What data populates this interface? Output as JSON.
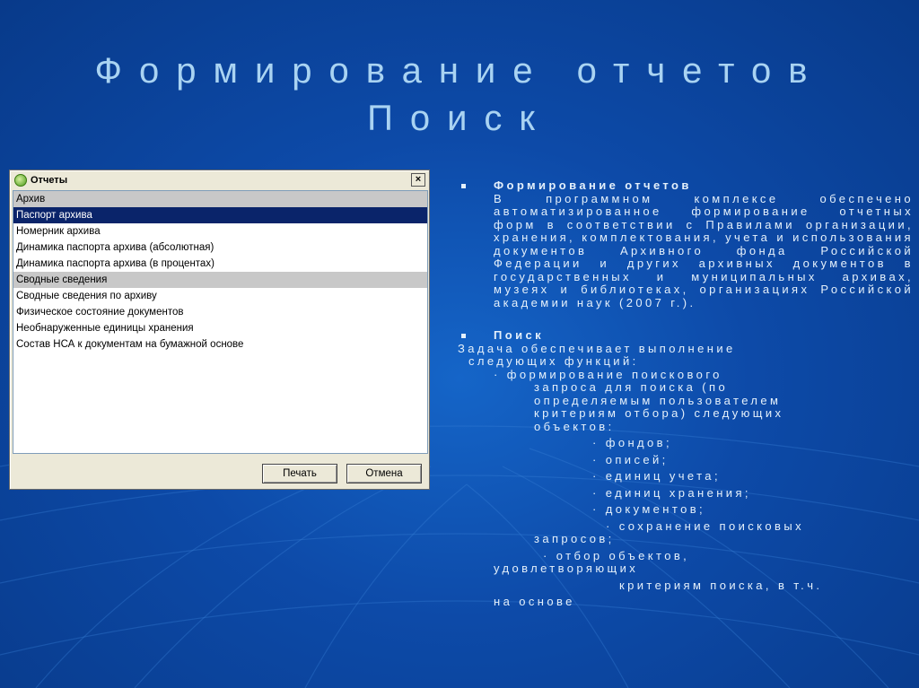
{
  "title": {
    "line1": "Формирование отчетов",
    "line2": "Поиск"
  },
  "dialog": {
    "title": "Отчеты",
    "close": "×",
    "items": [
      {
        "label": "Архив",
        "kind": "group"
      },
      {
        "label": "Паспорт архива",
        "kind": "selected"
      },
      {
        "label": "Номерник архива",
        "kind": "item"
      },
      {
        "label": "Динамика паспорта архива (абсолютная)",
        "kind": "item"
      },
      {
        "label": "Динамика паспорта архива (в процентах)",
        "kind": "item"
      },
      {
        "label": "Сводные сведения",
        "kind": "group"
      },
      {
        "label": "Сводные сведения по архиву",
        "kind": "item"
      },
      {
        "label": "Физическое состояние документов",
        "kind": "item"
      },
      {
        "label": "Необнаруженные единицы хранения",
        "kind": "item"
      },
      {
        "label": "Состав НСА к документам на бумажной основе",
        "kind": "item"
      }
    ],
    "print_label": "Печать",
    "cancel_label": "Отмена"
  },
  "panel": {
    "section1_title": "Формирование отчетов",
    "section1_text": "В программном комплексе обеспечено автоматизированное формирование отчетных форм в соответствии с Правилами организации, хранения, комплектования, учета и использования документов Архивного фонда Российской Федерации и других архивных документов в государственных и муниципальных архивах, музеях и библиотеках, организациях Российской академии наук (2007 г.).",
    "section2_title": "Поиск",
    "task_line1": "Задача обеспечивает выполнение",
    "task_line2": "следующих функций:",
    "func1_line1": "· формирование поискового",
    "func1_line2": "запроса для поиска (по",
    "func1_line3": "определяемым пользователем",
    "func1_line4": "критериям отбора) следующих",
    "func1_line5": "объектов:",
    "objects": [
      "· фондов;",
      "· описей;",
      "· единиц учета;",
      "· единиц хранения;",
      "· документов;"
    ],
    "func2_line1": "· сохранение поисковых",
    "func2_line2": "запросов;",
    "func3_line1": "· отбор объектов,",
    "func3_line2": "удовлетворяющих",
    "func3_line3": "критериям поиска, в т.ч.",
    "func3_line4": "на основе"
  }
}
